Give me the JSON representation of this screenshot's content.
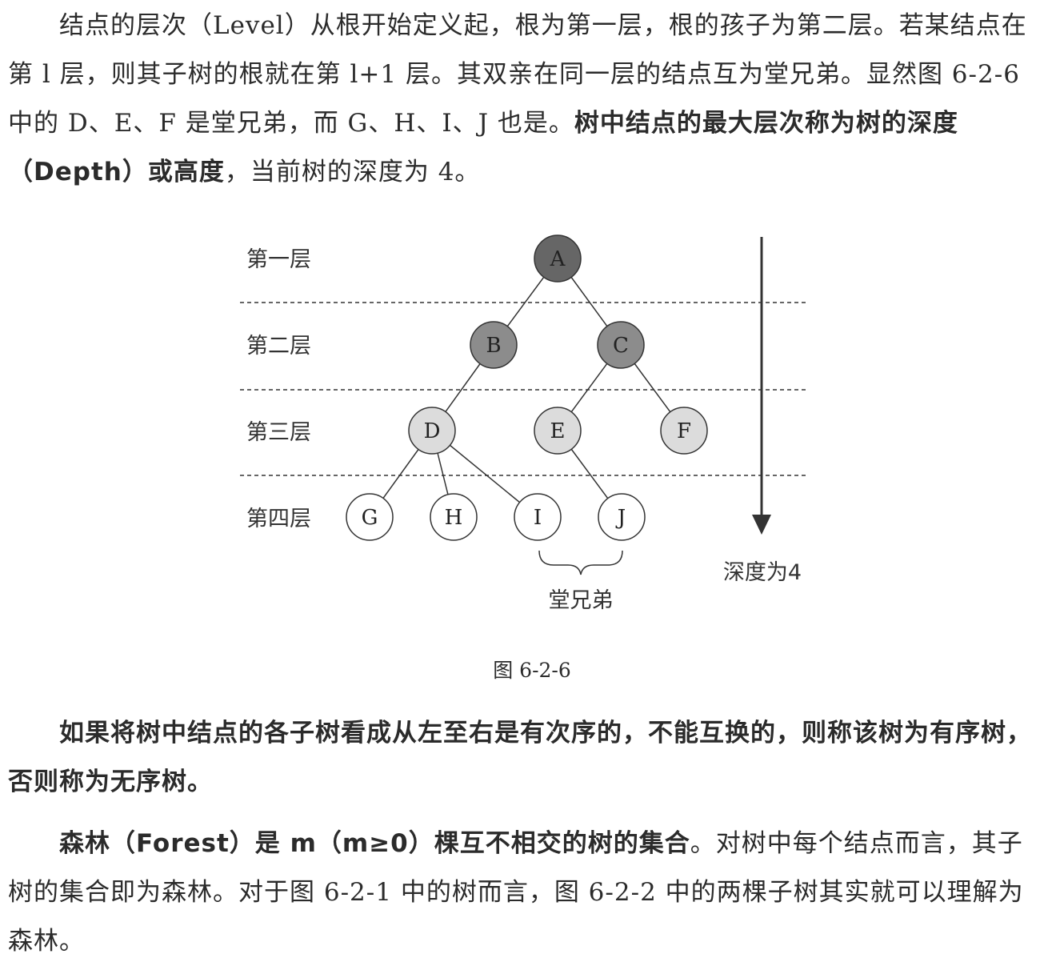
{
  "paragraphs": {
    "p1": {
      "s1": "结点的层次（Level）从根开始定义起，根为第一层，根的孩子为第二层。若某结点在第 l 层，则其子树的根就在第 l+1 层。其双亲在同一层的结点互为堂兄弟。显然图 6-2-6 中的 D、E、F 是堂兄弟，而 G、H、I、J 也是。",
      "s2": "树中结点的最大层次称为树的深度（Depth）或高度",
      "s3": "，当前树的深度为 4。"
    },
    "p2": {
      "s1": "如果将树中结点的各子树看成从左至右是有次序的，不能互换的，则称该树为有序树，否则称为无序树。"
    },
    "p3": {
      "s1": "森林（Forest）是 m（m≥0）棵互不相交的树的集合",
      "s2": "。对树中每个结点而言，其子树的集合即为森林。对于图 6-2-1 中的树而言，图 6-2-2 中的两棵子树其实就可以理解为森林。"
    }
  },
  "figure": {
    "levels": [
      "第一层",
      "第二层",
      "第三层",
      "第四层"
    ],
    "nodes": [
      "A",
      "B",
      "C",
      "D",
      "E",
      "F",
      "G",
      "H",
      "I",
      "J"
    ],
    "cousins_label": "堂兄弟",
    "depth_label": "深度为4",
    "caption": "图 6-2-6",
    "colors": {
      "dark": "#666666",
      "mid": "#8c8c8c",
      "light": "#dcdcdc",
      "white": "#ffffff",
      "line": "#333333"
    }
  }
}
